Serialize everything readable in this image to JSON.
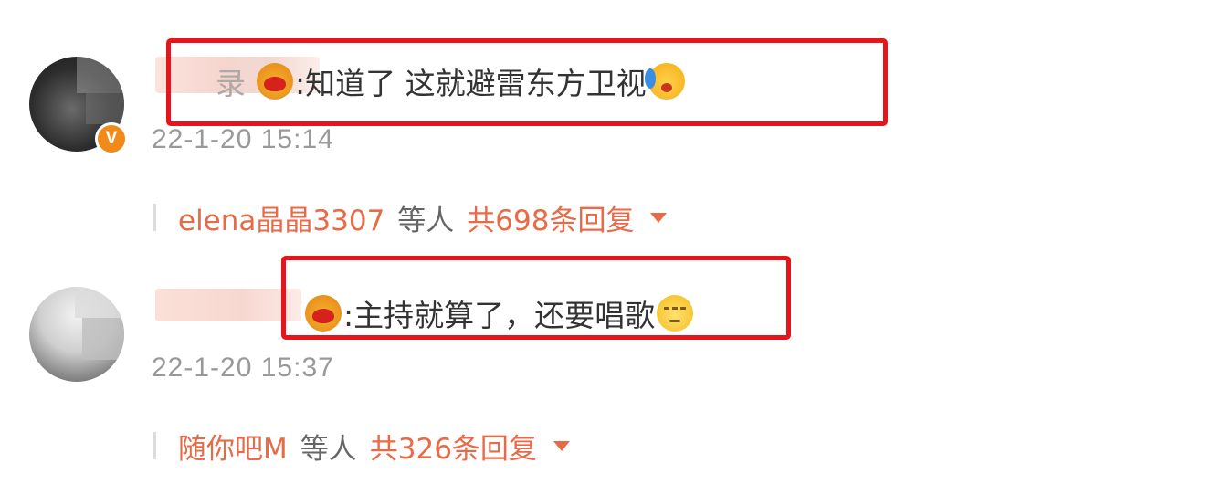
{
  "comments": [
    {
      "name_tail": "录",
      "content": ":知道了 这就避雷东方卫视",
      "emoji_before": "vip-emoji",
      "emoji_after": "crying-emoji",
      "timestamp": "22-1-20 15:14",
      "verified_badge": "V",
      "reply": {
        "users": "elena晶晶3307",
        "mid": "等人",
        "count": "共698条回复"
      }
    },
    {
      "content": ":主持就算了，还要唱歌",
      "emoji_before": "vip-emoji",
      "emoji_after": "speechless-emoji",
      "timestamp": "22-1-20 15:37",
      "reply": {
        "users": "随你吧M",
        "mid": "等人",
        "count": "共326条回复"
      }
    }
  ],
  "colors": {
    "highlight": "#e8141b",
    "link": "#e86a47",
    "timestamp": "#999999",
    "verified": "#f28a1a"
  }
}
